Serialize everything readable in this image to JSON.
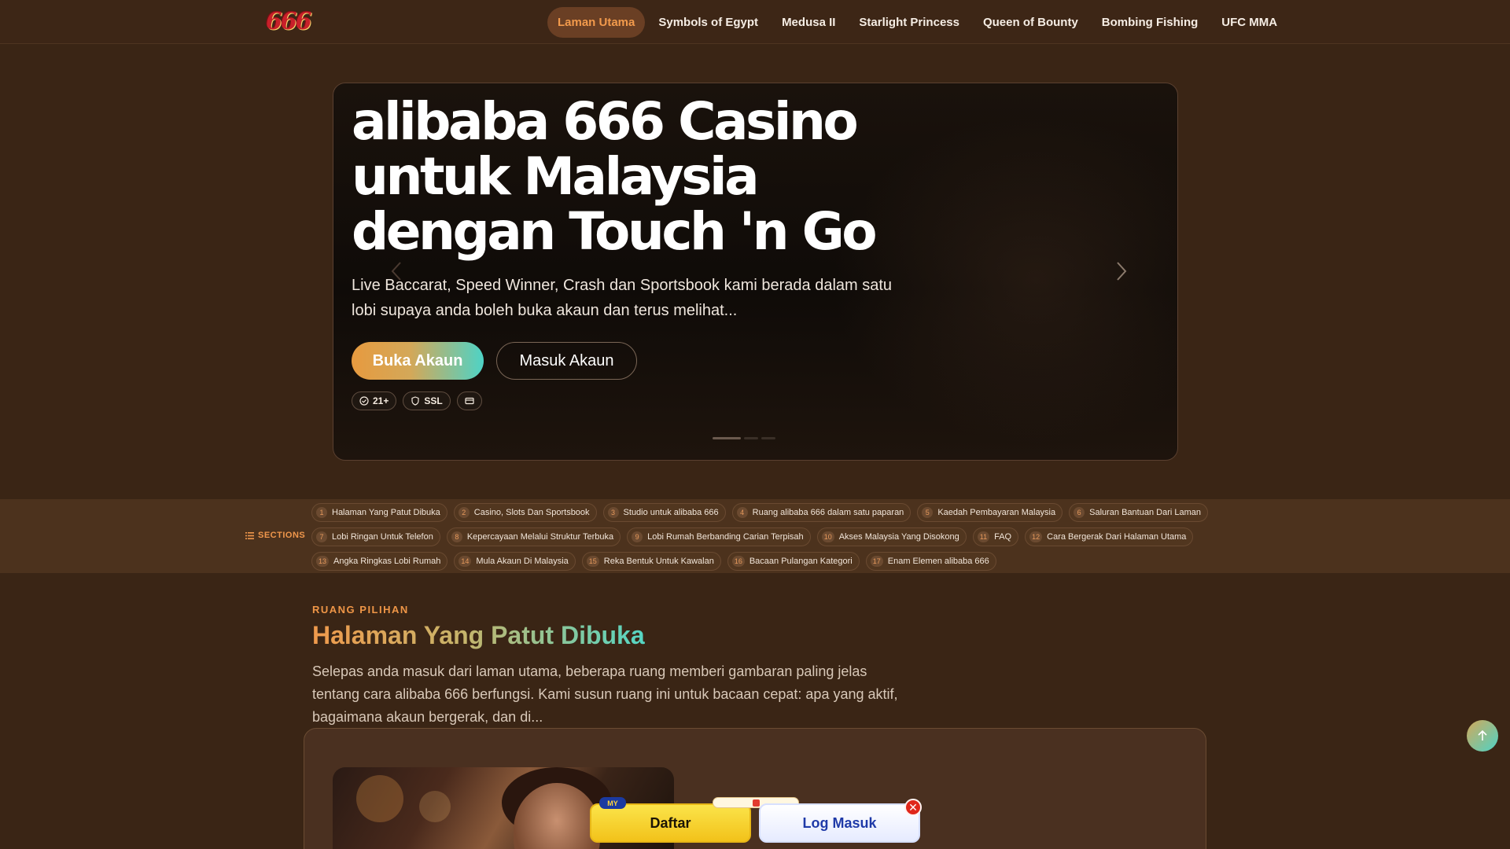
{
  "header": {
    "logo_text": "666",
    "nav": [
      {
        "label": "Laman Utama",
        "active": true
      },
      {
        "label": "Symbols of Egypt",
        "active": false
      },
      {
        "label": "Medusa II",
        "active": false
      },
      {
        "label": "Starlight Princess",
        "active": false
      },
      {
        "label": "Queen of Bounty",
        "active": false
      },
      {
        "label": "Bombing Fishing",
        "active": false
      },
      {
        "label": "UFC MMA",
        "active": false
      }
    ]
  },
  "hero": {
    "title": "alibaba 666 Casino untuk Malaysia dengan Touch 'n Go",
    "subtitle": "Live Baccarat, Speed Winner, Crash dan Sportsbook kami berada dalam satu lobi supaya anda boleh buka akaun dan terus melihat...",
    "primary_button": "Buka Akaun",
    "secondary_button": "Masuk Akaun",
    "badges": [
      {
        "icon": "check-circle-icon",
        "label": "21+"
      },
      {
        "icon": "shield-icon",
        "label": "SSL"
      },
      {
        "icon": "card-icon",
        "label": ""
      }
    ],
    "carousel_slides": 3,
    "carousel_active": 1
  },
  "sections": {
    "label": "SECTIONS",
    "items": [
      {
        "num": "1",
        "label": "Halaman Yang Patut Dibuka"
      },
      {
        "num": "2",
        "label": "Casino, Slots Dan Sportsbook"
      },
      {
        "num": "3",
        "label": "Studio untuk alibaba 666"
      },
      {
        "num": "4",
        "label": "Ruang alibaba 666 dalam satu paparan"
      },
      {
        "num": "5",
        "label": "Kaedah Pembayaran Malaysia"
      },
      {
        "num": "6",
        "label": "Saluran Bantuan Dari Laman"
      },
      {
        "num": "7",
        "label": "Lobi Ringan Untuk Telefon"
      },
      {
        "num": "8",
        "label": "Kepercayaan Melalui Struktur Terbuka"
      },
      {
        "num": "9",
        "label": "Lobi Rumah Berbanding Carian Terpisah"
      },
      {
        "num": "10",
        "label": "Akses Malaysia Yang Disokong"
      },
      {
        "num": "11",
        "label": "FAQ"
      },
      {
        "num": "12",
        "label": "Cara Bergerak Dari Halaman Utama"
      },
      {
        "num": "13",
        "label": "Angka Ringkas Lobi Rumah"
      },
      {
        "num": "14",
        "label": "Mula Akaun Di Malaysia"
      },
      {
        "num": "15",
        "label": "Reka Bentuk Untuk Kawalan"
      },
      {
        "num": "16",
        "label": "Bacaan Pulangan Kategori"
      },
      {
        "num": "17",
        "label": "Enam Elemen alibaba 666"
      }
    ]
  },
  "content": {
    "eyebrow": "RUANG PILIHAN",
    "heading": "Halaman Yang Patut Dibuka",
    "text": "Selepas anda masuk dari laman utama, beberapa ruang memberi gambaran paling jelas tentang cara alibaba 666 berfungsi. Kami susun ruang ini untuk bacaan cepat: apa yang aktif, bagaimana akaun bergerak, dan di..."
  },
  "floating_cta": {
    "register_label": "Daftar",
    "login_label": "Log Masuk",
    "flag_label": "MY",
    "close_label": "✕"
  },
  "colors": {
    "accent": "#f29a4c",
    "teal": "#4ed3c6",
    "background": "#3a2515"
  }
}
